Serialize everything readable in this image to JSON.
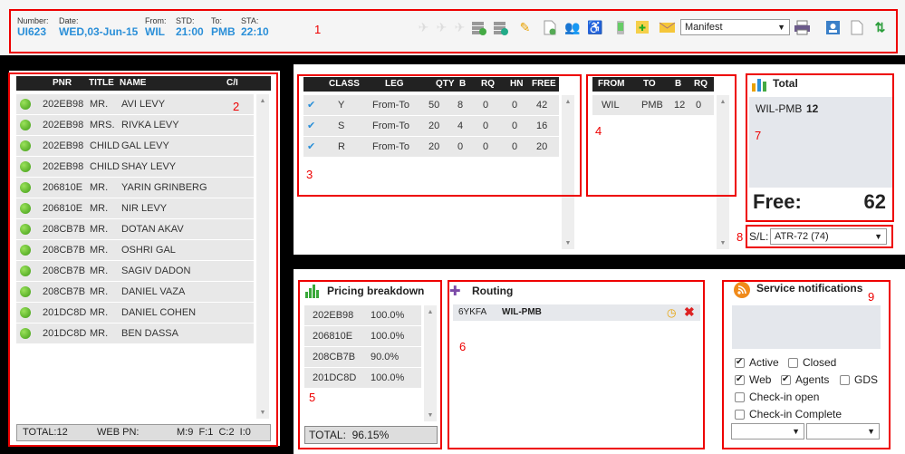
{
  "header": {
    "fields": [
      {
        "label": "Number:",
        "value": "UI623"
      },
      {
        "label": "Date:",
        "value": "WED,03-Jun-15"
      },
      {
        "label": "From:",
        "value": "WIL"
      },
      {
        "label": "STD:",
        "value": "21:00"
      },
      {
        "label": "To:",
        "value": "PMB"
      },
      {
        "label": "STA:",
        "value": "22:10"
      }
    ],
    "document_select": "Manifest"
  },
  "annotations": [
    "1",
    "2",
    "3",
    "4",
    "5",
    "6",
    "7",
    "8",
    "9"
  ],
  "passengers": {
    "columns": [
      "PNR",
      "TITLE",
      "NAME",
      "C/I"
    ],
    "rows": [
      {
        "pnr": "202EB98",
        "title": "MR.",
        "name": "AVI LEVY"
      },
      {
        "pnr": "202EB98",
        "title": "MRS.",
        "name": "RIVKA LEVY"
      },
      {
        "pnr": "202EB98",
        "title": "CHILD",
        "name": "GAL LEVY"
      },
      {
        "pnr": "202EB98",
        "title": "CHILD",
        "name": "SHAY LEVY"
      },
      {
        "pnr": "206810E",
        "title": "MR.",
        "name": "YARIN GRINBERG"
      },
      {
        "pnr": "206810E",
        "title": "MR.",
        "name": "NIR LEVY"
      },
      {
        "pnr": "208CB7B",
        "title": "MR.",
        "name": "DOTAN AKAV"
      },
      {
        "pnr": "208CB7B",
        "title": "MR.",
        "name": "OSHRI GAL"
      },
      {
        "pnr": "208CB7B",
        "title": "MR.",
        "name": "SAGIV DADON"
      },
      {
        "pnr": "208CB7B",
        "title": "MR.",
        "name": "DANIEL VAZA"
      },
      {
        "pnr": "201DC8D",
        "title": "MR.",
        "name": "DANIEL COHEN"
      },
      {
        "pnr": "201DC8D",
        "title": "MR.",
        "name": "BEN DASSA"
      }
    ],
    "footer": {
      "total": "TOTAL:12",
      "web": "WEB PN:",
      "counts": "M:9  F:1  C:2  I:0"
    }
  },
  "classes": {
    "columns": [
      "CLASS",
      "LEG",
      "QTY",
      "B",
      "RQ",
      "HN",
      "FREE"
    ],
    "rows": [
      {
        "class": "Y",
        "leg": "From-To",
        "qty": "50",
        "b": "8",
        "rq": "0",
        "hn": "0",
        "free": "42"
      },
      {
        "class": "S",
        "leg": "From-To",
        "qty": "20",
        "b": "4",
        "rq": "0",
        "hn": "0",
        "free": "16"
      },
      {
        "class": "R",
        "leg": "From-To",
        "qty": "20",
        "b": "0",
        "rq": "0",
        "hn": "0",
        "free": "20"
      }
    ]
  },
  "legs": {
    "columns": [
      "FROM",
      "TO",
      "B",
      "RQ"
    ],
    "rows": [
      {
        "from": "WIL",
        "to": "PMB",
        "b": "12",
        "rq": "0"
      }
    ]
  },
  "total": {
    "title": "Total",
    "route": "WIL-PMB",
    "count": "12",
    "free_label": "Free:",
    "free_value": "62"
  },
  "seat_layout": {
    "label": "S/L:",
    "value": "ATR-72 (74)"
  },
  "pricing": {
    "title": "Pricing breakdown",
    "rows": [
      {
        "pnr": "202EB98",
        "pct": "100.0%"
      },
      {
        "pnr": "206810E",
        "pct": "100.0%"
      },
      {
        "pnr": "208CB7B",
        "pct": "90.0%"
      },
      {
        "pnr": "201DC8D",
        "pct": "100.0%"
      }
    ],
    "total": "TOTAL:  96.15%"
  },
  "routing": {
    "title": "Routing",
    "code": "6YKFA",
    "route": "WIL-PMB"
  },
  "notifications": {
    "title": "Service notifications",
    "active": "Active",
    "closed": "Closed",
    "web": "Web",
    "agents": "Agents",
    "gds": "GDS",
    "checkin_open": "Check-in open",
    "checkin_complete": "Check-in Complete"
  }
}
